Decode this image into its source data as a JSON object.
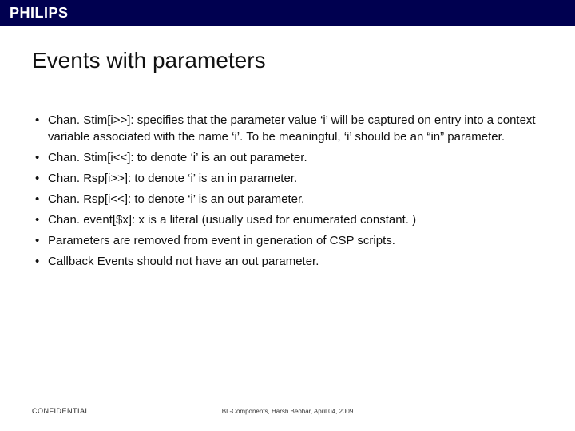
{
  "brand": "PHILIPS",
  "title": "Events with parameters",
  "bullets": [
    "Chan. Stim[i>>]: specifies that the parameter value ‘i’ will be captured on entry into a context variable associated with the name ‘i’. To be meaningful, ‘i’ should be an “in” parameter.",
    "Chan. Stim[i<<]: to denote ‘i’ is an out parameter.",
    "Chan. Rsp[i>>]: to denote ‘i’ is an in parameter.",
    "Chan. Rsp[i<<]: to denote ‘i’ is an out parameter.",
    "Chan. event[$x]: x is a literal (usually used for enumerated constant. )",
    "Parameters are removed from event in generation of CSP scripts.",
    "Callback Events should not have an out parameter."
  ],
  "footer": {
    "confidential": "CONFIDENTIAL",
    "meta": "BL-Components, Harsh Beohar, April 04, 2009"
  }
}
